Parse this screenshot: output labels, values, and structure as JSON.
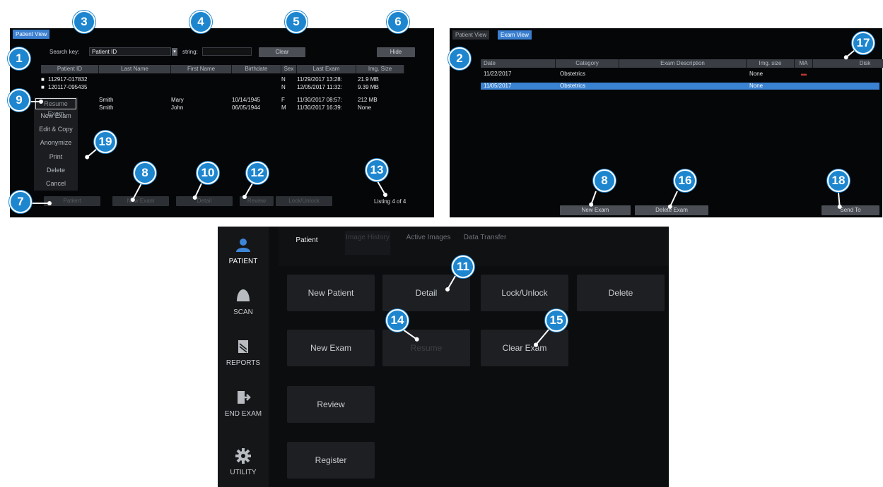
{
  "patient_view_panel": {
    "tab": "Patient View",
    "search_key_label": "Search key:",
    "search_key_value": "Patient ID",
    "string_label": "string:",
    "string_value": "",
    "clear_button": "Clear",
    "hide_button": "Hide",
    "columns": [
      "Patient ID",
      "Last Name",
      "First Name",
      "Birthdate",
      "Sex",
      "Last Exam",
      "Img. Size"
    ],
    "rows": [
      {
        "id": "112917-017832",
        "last": "",
        "first": "",
        "birth": "",
        "sex": "N",
        "exam": "11/29/2017 13:28:",
        "size": "21.9 MB"
      },
      {
        "id": "120117-095435",
        "last": "",
        "first": "",
        "birth": "",
        "sex": "N",
        "exam": "12/05/2017 11:32:",
        "size": "9.39 MB"
      },
      {
        "id": "",
        "last": "Smith",
        "first": "Mary",
        "birth": "10/14/1945",
        "sex": "F",
        "exam": "11/30/2017 08:57:",
        "size": "212 MB"
      },
      {
        "id": "",
        "last": "Smith",
        "first": "John",
        "birth": "06/05/1944",
        "sex": "M",
        "exam": "11/30/2017 16:39:",
        "size": "None"
      }
    ],
    "context_menu": [
      "Resume Exam",
      "New Exam",
      "Edit & Copy",
      "Anonymize",
      "Print",
      "Delete",
      "Cancel"
    ],
    "bottom_buttons": [
      "Patient",
      "New Exam",
      "Detail",
      "Review",
      "Lock/Unlock"
    ],
    "listing": "Listing 4 of 4"
  },
  "exam_view_panel": {
    "tabs": [
      "Patient View",
      "Exam View"
    ],
    "columns": [
      "Date",
      "Category",
      "Exam Description",
      "Img. size",
      "MA",
      "Disk"
    ],
    "rows": [
      {
        "date": "11/22/2017",
        "category": "Obstetrics",
        "desc": "",
        "size": "None",
        "ma": "",
        "disk": ""
      },
      {
        "date": "11/05/2017",
        "category": "Obstetrics",
        "desc": "",
        "size": "None",
        "ma": "",
        "disk": ""
      }
    ],
    "new_exam_button": "New Exam",
    "delete_exam_button": "Delete Exam",
    "send_to_button": "Send To"
  },
  "touch_panel": {
    "sidebar": [
      {
        "label": "PATIENT",
        "icon": "person-icon"
      },
      {
        "label": "SCAN",
        "icon": "probe-icon"
      },
      {
        "label": "REPORTS",
        "icon": "reports-icon"
      },
      {
        "label": "END EXAM",
        "icon": "exit-icon"
      },
      {
        "label": "UTILITY",
        "icon": "gear-icon"
      }
    ],
    "tabs": [
      "Patient",
      "Image History",
      "Active Images",
      "Data Transfer"
    ],
    "buttons": {
      "new_patient": "New Patient",
      "detail": "Detail",
      "lock_unlock": "Lock/Unlock",
      "delete": "Delete",
      "new_exam": "New Exam",
      "resume": "Resume",
      "clear_exam": "Clear Exam",
      "review": "Review",
      "register": "Register"
    }
  },
  "callouts": [
    "1",
    "2",
    "3",
    "4",
    "5",
    "6",
    "7",
    "8",
    "9",
    "10",
    "11",
    "12",
    "13",
    "14",
    "15",
    "16",
    "17",
    "18",
    "19"
  ],
  "colors": {
    "accent": "#1e86cf",
    "tab_active": "#3a7fd0",
    "panel_bg": "#050608",
    "button": "#4b4f55"
  }
}
